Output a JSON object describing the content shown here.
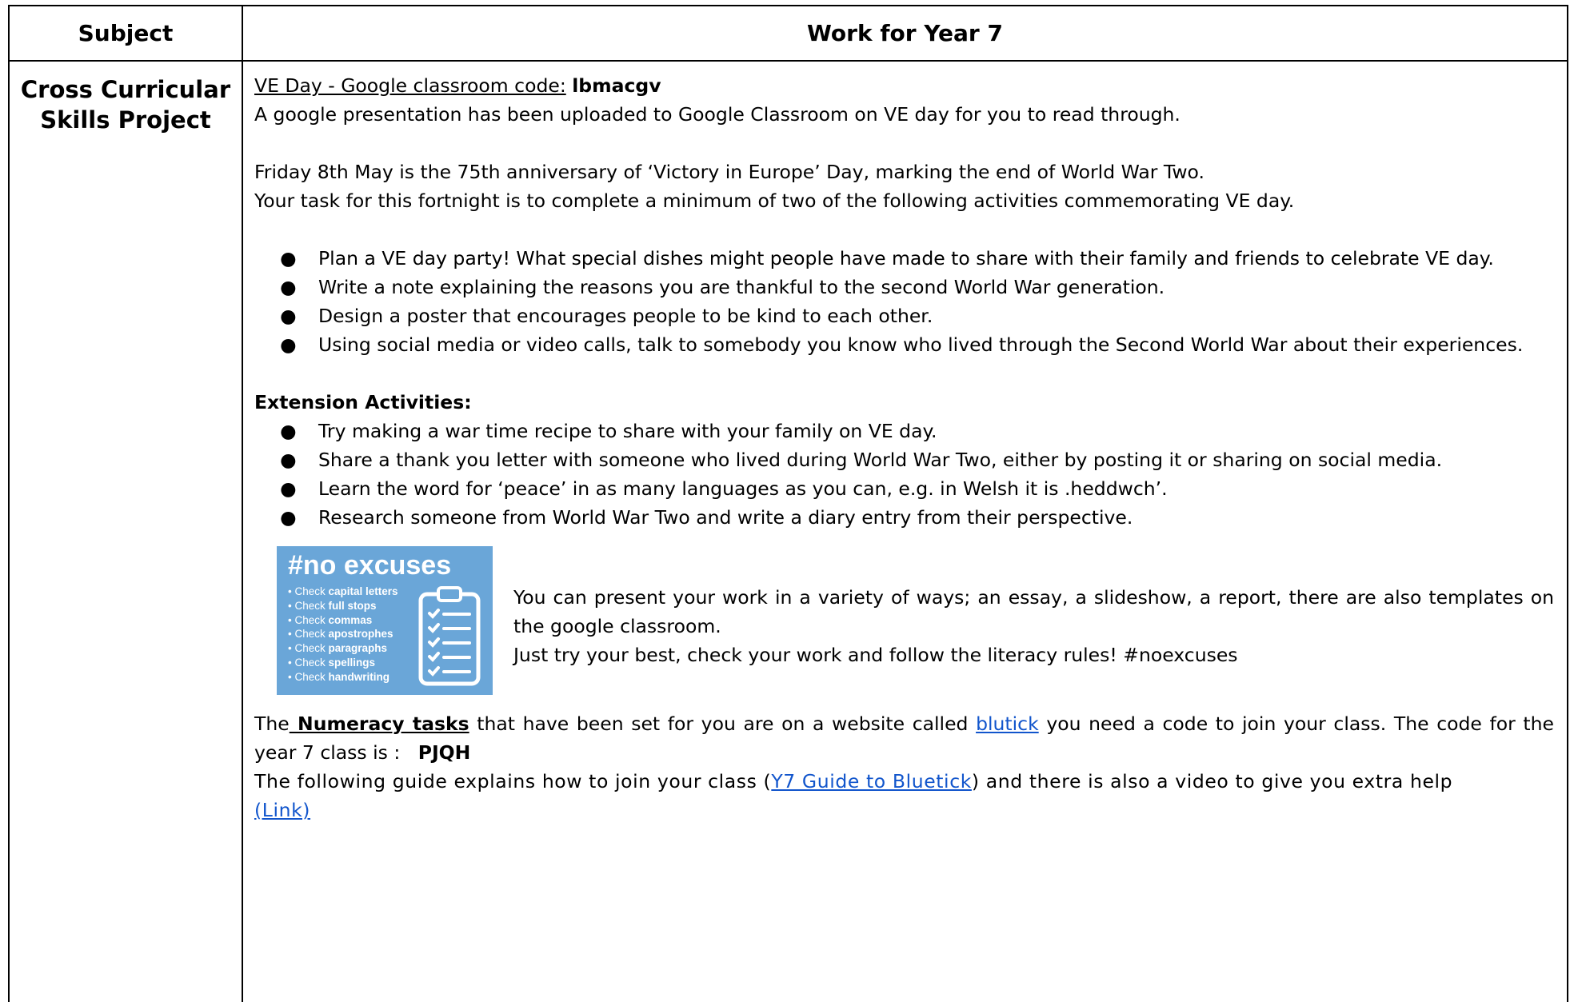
{
  "header": {
    "subject": "Subject",
    "work": "Work for Year 7"
  },
  "row": {
    "subject": "Cross Curricular Skills Project",
    "classroom_prefix": "VE Day - Google classroom code:",
    "classroom_code": "lbmacgv",
    "intro": "A google presentation has been uploaded to Google Classroom on VE day for you to read through.",
    "para1": "Friday 8th May is the 75th anniversary of ‘Victory in Europe’ Day, marking the end of World War Two.",
    "para2": "Your task for this fortnight is to complete a minimum of two of the following activities commemorating VE day.",
    "activities": [
      "Plan a VE day party! What special dishes might people have made to share with their family and friends to celebrate VE day.",
      "Write a note explaining the reasons you are thankful to the second World War generation.",
      "Design a poster that encourages people to be kind to each other.",
      "Using social media or video calls, talk to somebody you know who lived through the Second World War about their experiences."
    ],
    "extension_title": "Extension Activities:",
    "extensions": [
      "Try making a war time recipe to share with your family on VE day.",
      "Share a thank you letter with someone who lived during World War Two, either by posting it or sharing on social media.",
      "Learn the word for ‘peace’ in as many languages as you can, e.g. in Welsh it is .heddwch’.",
      "Research someone from World War Two and write a diary entry from their perspective."
    ],
    "bullet": "●",
    "poster": {
      "title": "#no excuses",
      "items": [
        {
          "pre": "Check ",
          "bold": "capital letters"
        },
        {
          "pre": "Check ",
          "bold": "full stops"
        },
        {
          "pre": "Check ",
          "bold": "commas"
        },
        {
          "pre": "Check ",
          "bold": "apostrophes"
        },
        {
          "pre": "Check ",
          "bold": "paragraphs"
        },
        {
          "pre": "Check ",
          "bold": "spellings"
        },
        {
          "pre": "Check ",
          "bold": "handwriting"
        }
      ],
      "icon": "clipboard-checklist-icon",
      "bg_color": "#6aa6d8"
    },
    "present_line1": "You can present your work in a variety of ways; an essay, a slideshow, a report, there are also templates on the google classroom.",
    "present_line2": "Just try your best, check your work and follow the literacy rules! #noexcuses",
    "numeracy_the": "The",
    "numeracy_link": " Numeracy tasks",
    "numeracy_mid": " that have been set for you are on a website called ",
    "blutick_link": "blutick",
    "numeracy_end": " you need a code to join your class. The code for the year 7 class is :",
    "class_code": "PJQH",
    "guide_pre": "The following guide explains how to join your class (",
    "guide_link": "Y7 Guide to Bluetick",
    "guide_mid": ") and there is also a video to give you extra help",
    "video_link": "(Link)",
    "link_color": "#1155cc"
  }
}
